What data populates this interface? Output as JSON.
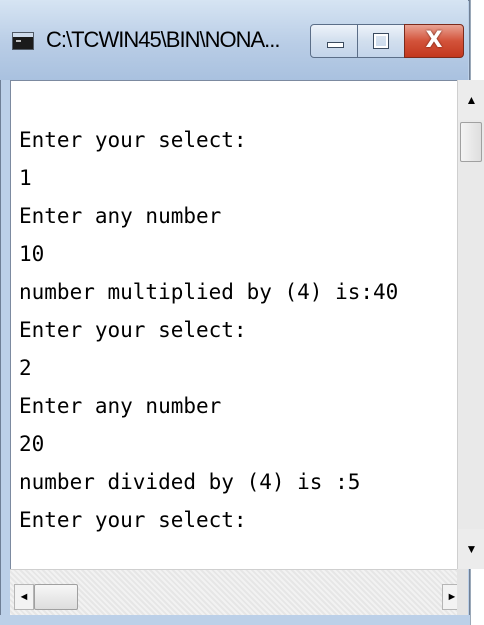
{
  "window": {
    "title": "C:\\TCWIN45\\BIN\\NONA...",
    "minimize_glyph": "minimize-icon",
    "maximize_glyph": "maximize-icon",
    "close_label": "X"
  },
  "console": {
    "lines": [
      "Enter your select:",
      "1",
      "Enter any number",
      "10",
      "number multiplied by (4) is:40",
      "Enter your select:",
      "2",
      "Enter any number",
      "20",
      "number divided by (4) is :5",
      "Enter your select:"
    ]
  },
  "scrollbars": {
    "up_arrow": "▲",
    "down_arrow": "▼",
    "left_arrow": "◄",
    "right_arrow": "►"
  },
  "colors": {
    "title_bar": "#b9cde6",
    "close_button": "#d3533a",
    "console_background": "#ffffff",
    "console_text": "#000000"
  }
}
